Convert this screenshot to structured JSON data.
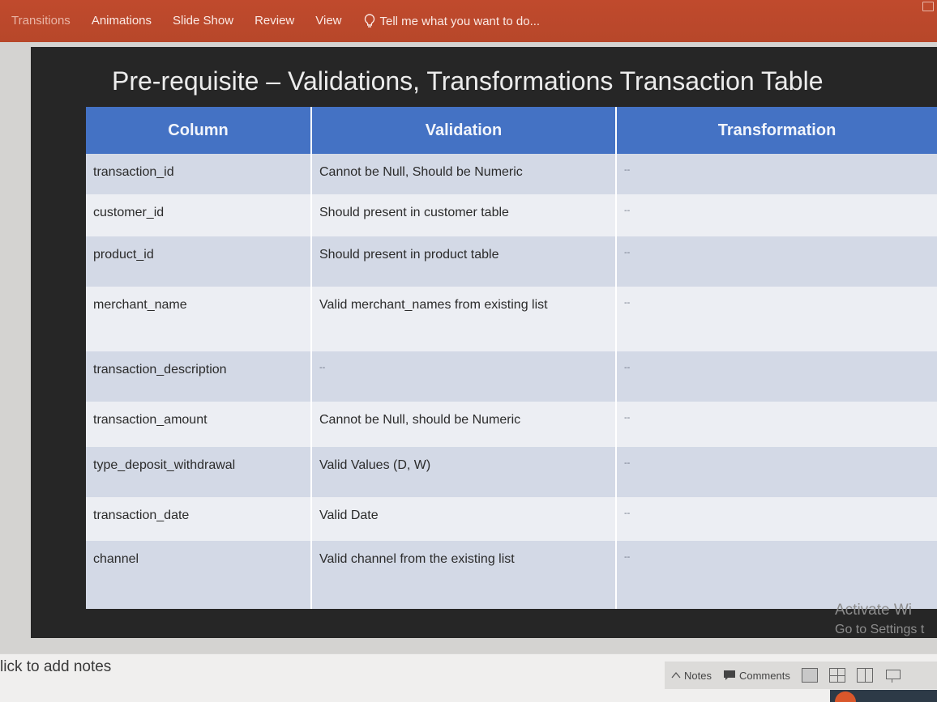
{
  "ribbon": {
    "tabs": [
      "Transitions",
      "Animations",
      "Slide Show",
      "Review",
      "View"
    ],
    "tell_me": "Tell me what you want to do..."
  },
  "slide": {
    "title": "Pre-requisite – Validations, Transformations Transaction Table",
    "table": {
      "headers": [
        "Column",
        "Validation",
        "Transformation"
      ],
      "rows": [
        {
          "column": "transaction_id",
          "validation": "Cannot be Null, Should be Numeric",
          "transformation": "--"
        },
        {
          "column": "customer_id",
          "validation": "Should present in customer table",
          "transformation": "--"
        },
        {
          "column": "product_id",
          "validation": "Should present in product table",
          "transformation": "--"
        },
        {
          "column": "merchant_name",
          "validation": "Valid merchant_names from existing list",
          "transformation": "--"
        },
        {
          "column": "transaction_description",
          "validation": "--",
          "transformation": "--"
        },
        {
          "column": "transaction_amount",
          "validation": "Cannot be Null, should be Numeric",
          "transformation": "--"
        },
        {
          "column": "type_deposit_withdrawal",
          "validation": "Valid Values (D, W)",
          "transformation": "--"
        },
        {
          "column": "transaction_date",
          "validation": "Valid Date",
          "transformation": "--"
        },
        {
          "column": "channel",
          "validation": "Valid channel from the existing list",
          "transformation": "--"
        }
      ]
    }
  },
  "watermark": {
    "line1": "Activate Wi",
    "line2": "Go to Settings t"
  },
  "notes": {
    "placeholder": "lick to add notes"
  },
  "status_bar": {
    "notes_label": "Notes",
    "comments_label": "Comments"
  },
  "colors": {
    "ribbon": "#b7472a",
    "header": "#4472c4",
    "row_odd": "#d3d9e6",
    "row_even": "#eceef3"
  }
}
